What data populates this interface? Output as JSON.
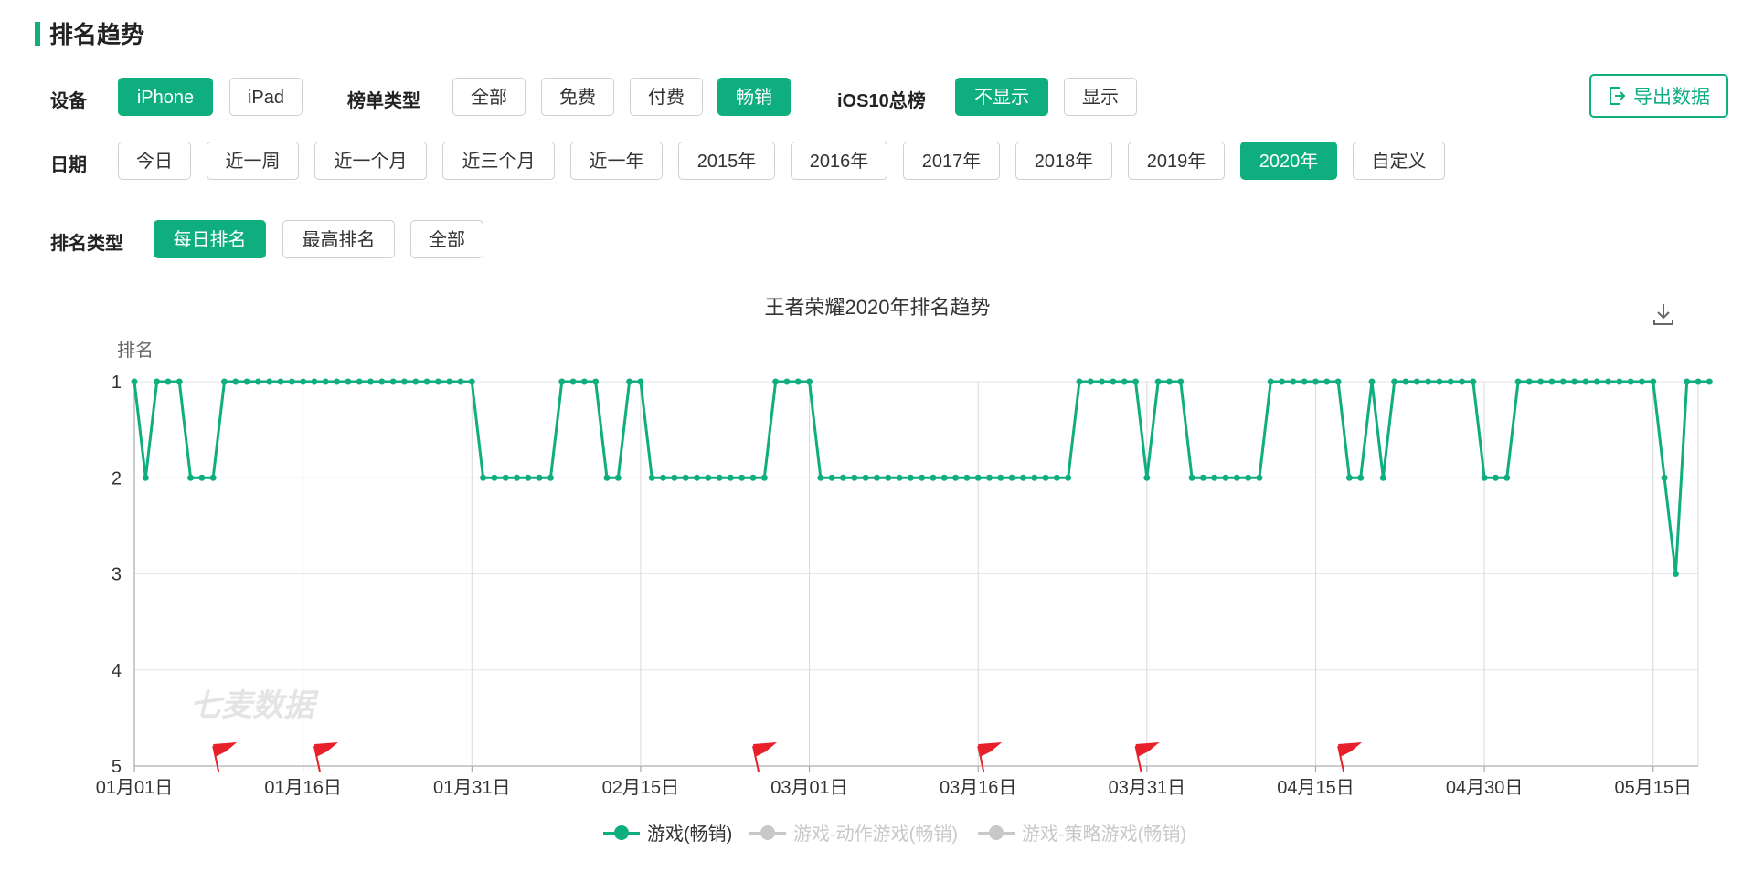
{
  "section": {
    "title": "排名趋势"
  },
  "filters": {
    "device": {
      "label": "设备",
      "options": [
        "iPhone",
        "iPad"
      ],
      "selected": "iPhone"
    },
    "list_type": {
      "label": "榜单类型",
      "options": [
        "全部",
        "免费",
        "付费",
        "畅销"
      ],
      "selected": "畅销"
    },
    "ios10": {
      "label": "iOS10总榜",
      "options": [
        "不显示",
        "显示"
      ],
      "selected": "不显示"
    },
    "date": {
      "label": "日期",
      "options": [
        "今日",
        "近一周",
        "近一个月",
        "近三个月",
        "近一年",
        "2015年",
        "2016年",
        "2017年",
        "2018年",
        "2019年",
        "2020年",
        "自定义"
      ],
      "selected": "2020年"
    },
    "rank_type": {
      "label": "排名类型",
      "options": [
        "每日排名",
        "最高排名",
        "全部"
      ],
      "selected": "每日排名"
    }
  },
  "export_label": "导出数据",
  "icons": {
    "export": "export-icon",
    "download": "download-icon",
    "flag": "flag-icon"
  },
  "colors": {
    "accent": "#0fae7f",
    "inactive_legend": "#c8c8c8",
    "flag": "#e8202a"
  },
  "watermark": "七麦数据",
  "chart_data": {
    "type": "line",
    "title": "王者荣耀2020年排名趋势",
    "ylabel": "排名",
    "xlabel": "",
    "y_inverted": true,
    "ylim": [
      1,
      5
    ],
    "yticks": [
      "1",
      "2",
      "3",
      "4",
      "5"
    ],
    "xticks": [
      "01月01日",
      "01月16日",
      "01月31日",
      "02月15日",
      "03月01日",
      "03月16日",
      "03月31日",
      "04月15日",
      "04月30日",
      "05月15日"
    ],
    "x_start": "2020-01-01",
    "x_end": "2020-05-19",
    "grid": true,
    "legend_position": "bottom",
    "series": [
      {
        "name": "游戏(畅销)",
        "active": true,
        "values": [
          1,
          2,
          1,
          1,
          1,
          2,
          2,
          2,
          1,
          1,
          1,
          1,
          1,
          1,
          1,
          1,
          1,
          1,
          1,
          1,
          1,
          1,
          1,
          1,
          1,
          1,
          1,
          1,
          1,
          1,
          1,
          2,
          2,
          2,
          2,
          2,
          2,
          2,
          1,
          1,
          1,
          1,
          2,
          2,
          1,
          1,
          2,
          2,
          2,
          2,
          2,
          2,
          2,
          2,
          2,
          2,
          2,
          1,
          1,
          1,
          1,
          2,
          2,
          2,
          2,
          2,
          2,
          2,
          2,
          2,
          2,
          2,
          2,
          2,
          2,
          2,
          2,
          2,
          2,
          2,
          2,
          2,
          2,
          2,
          1,
          1,
          1,
          1,
          1,
          1,
          2,
          1,
          1,
          1,
          2,
          2,
          2,
          2,
          2,
          2,
          2,
          1,
          1,
          1,
          1,
          1,
          1,
          1,
          2,
          2,
          1,
          2,
          1,
          1,
          1,
          1,
          1,
          1,
          1,
          1,
          2,
          2,
          2,
          1,
          1,
          1,
          1,
          1,
          1,
          1,
          1,
          1,
          1,
          1,
          1,
          1,
          2,
          3,
          1,
          1,
          1
        ]
      },
      {
        "name": "游戏-动作游戏(畅销)",
        "active": false,
        "values": []
      },
      {
        "name": "游戏-策略游戏(畅销)",
        "active": false,
        "values": []
      }
    ],
    "event_flags": [
      "2020-01-08",
      "2020-01-17",
      "2020-02-25",
      "2020-03-16",
      "2020-03-30",
      "2020-04-17"
    ]
  }
}
